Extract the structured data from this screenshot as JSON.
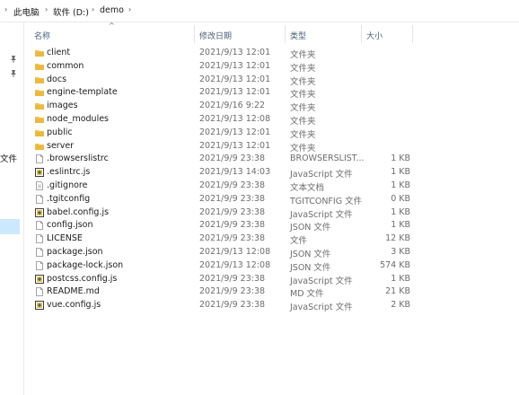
{
  "breadcrumb": {
    "items": [
      "此电脑",
      "软件 (D:)",
      "demo"
    ]
  },
  "nav": {
    "partial_label": "文件"
  },
  "columns": {
    "name": "名称",
    "date": "修改日期",
    "type": "类型",
    "size": "大小"
  },
  "files": [
    {
      "name": "client",
      "date": "2021/9/13 12:01",
      "type": "文件夹",
      "size": "",
      "icon": "folder-icon"
    },
    {
      "name": "common",
      "date": "2021/9/13 12:01",
      "type": "文件夹",
      "size": "",
      "icon": "folder-icon"
    },
    {
      "name": "docs",
      "date": "2021/9/13 12:01",
      "type": "文件夹",
      "size": "",
      "icon": "folder-icon"
    },
    {
      "name": "engine-template",
      "date": "2021/9/13 12:01",
      "type": "文件夹",
      "size": "",
      "icon": "folder-icon"
    },
    {
      "name": "images",
      "date": "2021/9/16 9:22",
      "type": "文件夹",
      "size": "",
      "icon": "folder-icon"
    },
    {
      "name": "node_modules",
      "date": "2021/9/13 12:08",
      "type": "文件夹",
      "size": "",
      "icon": "folder-icon"
    },
    {
      "name": "public",
      "date": "2021/9/13 12:01",
      "type": "文件夹",
      "size": "",
      "icon": "folder-icon"
    },
    {
      "name": "server",
      "date": "2021/9/13 12:01",
      "type": "文件夹",
      "size": "",
      "icon": "folder-icon"
    },
    {
      "name": ".browserslistrc",
      "date": "2021/9/9 23:38",
      "type": "BROWSERSLIST...",
      "size": "1 KB",
      "icon": "file-icon"
    },
    {
      "name": ".eslintrc.js",
      "date": "2021/9/13 14:03",
      "type": "JavaScript 文件",
      "size": "1 KB",
      "icon": "js-file-icon"
    },
    {
      "name": ".gitignore",
      "date": "2021/9/9 23:38",
      "type": "文本文档",
      "size": "1 KB",
      "icon": "text-file-icon"
    },
    {
      "name": ".tgitconfig",
      "date": "2021/9/9 23:38",
      "type": "TGITCONFIG 文件",
      "size": "0 KB",
      "icon": "file-icon"
    },
    {
      "name": "babel.config.js",
      "date": "2021/9/9 23:38",
      "type": "JavaScript 文件",
      "size": "1 KB",
      "icon": "js-file-icon"
    },
    {
      "name": "config.json",
      "date": "2021/9/9 23:38",
      "type": "JSON 文件",
      "size": "1 KB",
      "icon": "file-icon"
    },
    {
      "name": "LICENSE",
      "date": "2021/9/9 23:38",
      "type": "文件",
      "size": "12 KB",
      "icon": "file-icon"
    },
    {
      "name": "package.json",
      "date": "2021/9/13 12:08",
      "type": "JSON 文件",
      "size": "3 KB",
      "icon": "file-icon"
    },
    {
      "name": "package-lock.json",
      "date": "2021/9/13 12:08",
      "type": "JSON 文件",
      "size": "574 KB",
      "icon": "file-icon"
    },
    {
      "name": "postcss.config.js",
      "date": "2021/9/9 23:38",
      "type": "JavaScript 文件",
      "size": "1 KB",
      "icon": "js-file-icon"
    },
    {
      "name": "README.md",
      "date": "2021/9/9 23:38",
      "type": "MD 文件",
      "size": "21 KB",
      "icon": "file-icon"
    },
    {
      "name": "vue.config.js",
      "date": "2021/9/9 23:38",
      "type": "JavaScript 文件",
      "size": "2 KB",
      "icon": "js-file-icon"
    }
  ],
  "colors": {
    "folder": "#f3c34e",
    "folder_dark": "#dca52c",
    "header_text": "#4c607a",
    "selection": "#cce8ff",
    "js_icon": "#3b3b3b"
  }
}
